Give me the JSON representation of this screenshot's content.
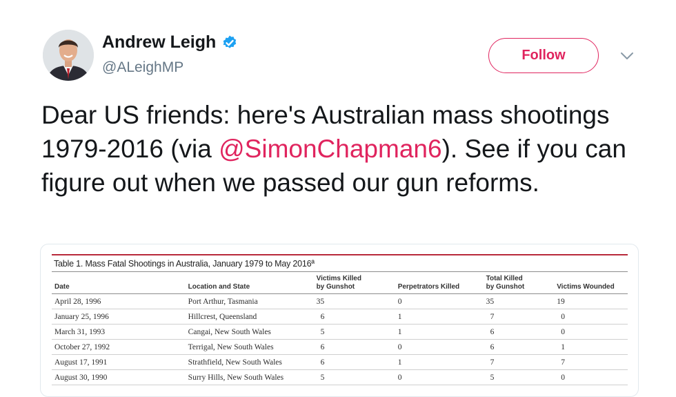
{
  "author": {
    "name": "Andrew Leigh",
    "handle": "@ALeighMP",
    "verified": true
  },
  "follow_label": "Follow",
  "tweet": {
    "text_before": "Dear US friends: here's Australian mass shootings 1979-2016 (via ",
    "mention": "@SimonChapman6",
    "text_after": "). See if you can figure out when we passed our gun reforms."
  },
  "colors": {
    "accent": "#e0245e",
    "verified": "#1da1f2",
    "table_rule": "#b8283a",
    "text": "#14171a",
    "muted": "#657786"
  },
  "icons": {
    "verified": "verified-badge-icon",
    "menu": "chevron-down-icon"
  },
  "table": {
    "title": "Table 1. Mass Fatal Shootings in Australia, January 1979 to May 2016ª",
    "headers": [
      [
        "",
        "Date"
      ],
      [
        "",
        "Location and State"
      ],
      [
        "Victims Killed",
        "by Gunshot"
      ],
      [
        "",
        "Perpetrators Killed"
      ],
      [
        "Total Killed",
        "by Gunshot"
      ],
      [
        "",
        "Victims Wounded"
      ]
    ],
    "rows": [
      [
        "April 28, 1996",
        "Port Arthur, Tasmania",
        "35",
        "0",
        "35",
        "19"
      ],
      [
        "January 25, 1996",
        "Hillcrest, Queensland",
        "6",
        "1",
        "7",
        "0"
      ],
      [
        "March 31, 1993",
        "Cangai, New South Wales",
        "5",
        "1",
        "6",
        "0"
      ],
      [
        "October 27, 1992",
        "Terrigal, New South Wales",
        "6",
        "0",
        "6",
        "1"
      ],
      [
        "August 17, 1991",
        "Strathfield, New South Wales",
        "6",
        "1",
        "7",
        "7"
      ],
      [
        "August 30, 1990",
        "Surry Hills, New South Wales",
        "5",
        "0",
        "5",
        "0"
      ]
    ]
  }
}
